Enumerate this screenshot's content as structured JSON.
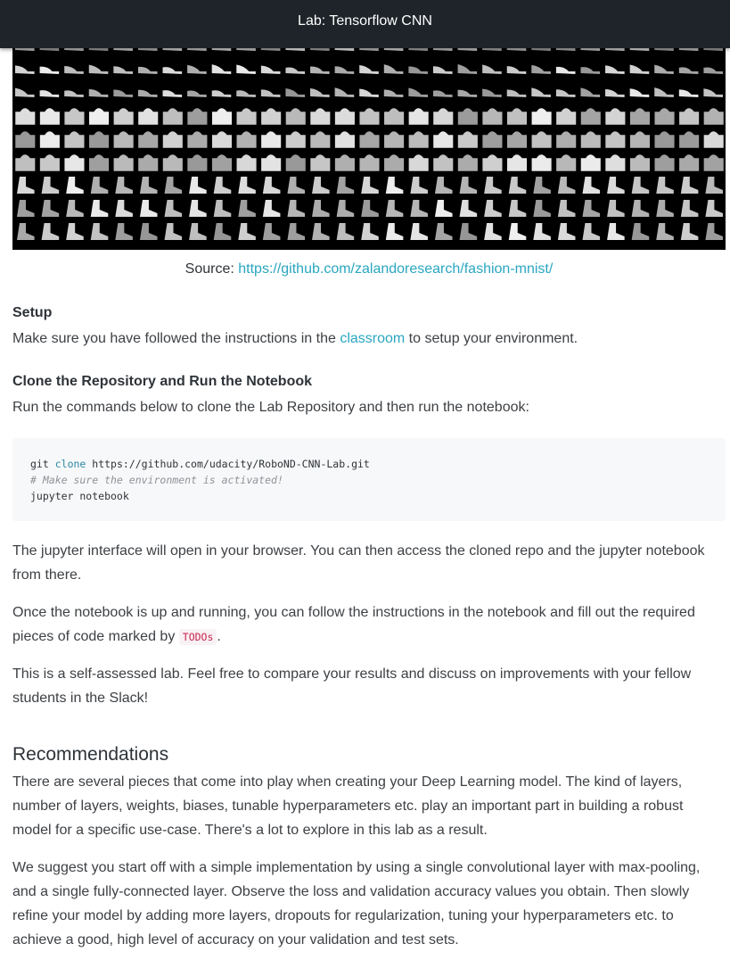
{
  "header": {
    "title": "Lab: Tensorflow CNN"
  },
  "figure": {
    "caption_label": "Source:",
    "caption_link": "https://github.com/zalandoresearch/fashion-mnist/",
    "tile_color": "#b8b8b8",
    "background_color": "#000000"
  },
  "setup": {
    "heading": "Setup",
    "text_before": "Make sure you have followed the instructions in the ",
    "link": "classroom",
    "text_after": " to setup your environment."
  },
  "clone": {
    "heading": "Clone the Repository and Run the Notebook",
    "text": "Run the commands below to clone the Lab Repository and then run the notebook:"
  },
  "code": {
    "line1_cmd": "git",
    "line1_kw": "clone",
    "line1_arg": "https://github.com/udacity/RoboND-CNN-Lab.git",
    "line2_comment": "# Make sure the environment is activated!",
    "line3": "jupyter notebook"
  },
  "paragraphs": {
    "p1": "The jupyter interface will open in your browser. You can then access the cloned repo and the jupyter notebook from there.",
    "p2_before": "Once the notebook is up and running, you can follow the instructions in the notebook and fill out the required pieces of code marked by ",
    "p2_code": "TODOs",
    "p2_after": ".",
    "p3": "This is a self-assessed lab. Feel free to compare your results and discuss on improvements with your fellow students in the Slack!"
  },
  "recommendations": {
    "heading": "Recommendations",
    "p1": "There are several pieces that come into play when creating your Deep Learning model. The kind of layers, number of layers, weights, biases, tunable hyperparameters etc. play an important part in building a robust model for a specific use-case. There's a lot to explore in this lab as a result.",
    "p2": "We suggest you start off with a simple implementation by using a single convolutional layer with max-pooling, and a single fully-connected layer. Observe the loss and validation accuracy values you obtain. Then slowly refine your model by adding more layers, dropouts for regularization, tuning your hyperparameters etc. to achieve a good, high level of accuracy on your validation and test sets."
  }
}
